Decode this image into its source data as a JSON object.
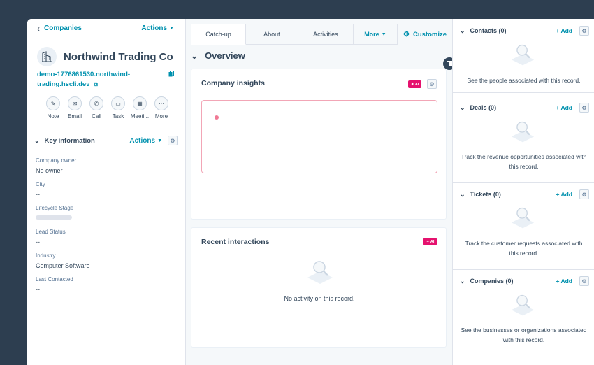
{
  "left": {
    "back_label": "Companies",
    "actions_label": "Actions",
    "company_name": "Northwind Trading Co",
    "domain": "demo-1776861530.northwind-trading.hscli.dev",
    "quick_actions": [
      {
        "label": "Note",
        "icon": "note-icon"
      },
      {
        "label": "Email",
        "icon": "email-icon"
      },
      {
        "label": "Call",
        "icon": "call-icon"
      },
      {
        "label": "Task",
        "icon": "task-icon"
      },
      {
        "label": "Meeti...",
        "icon": "meeting-icon"
      },
      {
        "label": "More",
        "icon": "more-icon"
      }
    ],
    "key_info": {
      "title": "Key information",
      "actions_label": "Actions",
      "properties": [
        {
          "label": "Company owner",
          "value": "No owner"
        },
        {
          "label": "City",
          "value": "--"
        },
        {
          "label": "Lifecycle Stage",
          "value": ""
        },
        {
          "label": "Lead Status",
          "value": "--"
        },
        {
          "label": "Industry",
          "value": "Computer Software"
        },
        {
          "label": "Last Contacted",
          "value": "--"
        }
      ]
    }
  },
  "middle": {
    "tabs": [
      "Catch-up",
      "About",
      "Activities",
      "More"
    ],
    "customize_label": "Customize",
    "overview_title": "Overview",
    "insights": {
      "title": "Company insights",
      "ai_badge": "✦ AI"
    },
    "interactions": {
      "title": "Recent interactions",
      "ai_badge": "✦ AI",
      "empty_text": "No activity on this record."
    }
  },
  "right": {
    "add_label": "+ Add",
    "sections": [
      {
        "title": "Contacts (0)",
        "text": "See the people associated with this record."
      },
      {
        "title": "Deals (0)",
        "text": "Track the revenue opportunities associated with this record."
      },
      {
        "title": "Tickets (0)",
        "text": "Track the customer requests associated with this record."
      },
      {
        "title": "Companies (0)",
        "text": "See the businesses or organizations associated with this record."
      }
    ]
  },
  "colors": {
    "accent": "#0091ae",
    "ai": "#e5126e",
    "text": "#33475b",
    "background": "#2d3e50"
  }
}
